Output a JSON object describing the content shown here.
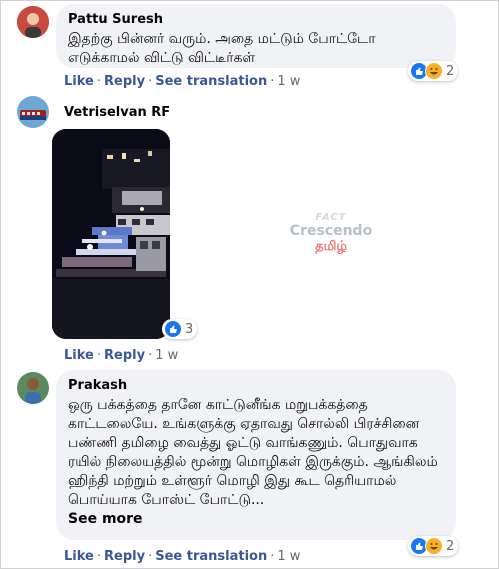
{
  "comments": [
    {
      "author": "Pattu Suresh",
      "text": "இதற்கு பின்னர் வரும். அதை மட்டும் போட்டோ எடுக்காமல் விட்டு விட்டீர்கள்",
      "actions": {
        "like": "Like",
        "reply": "Reply",
        "translate": "See translation",
        "time": "1 w"
      },
      "reaction_count": "2"
    },
    {
      "author": "Vetriselvan RF",
      "actions": {
        "like": "Like",
        "reply": "Reply",
        "time": "1 w"
      },
      "reaction_count": "3"
    },
    {
      "author": "Prakash",
      "text": "ஒரு பக்கத்தை தானே காட்டுனீங்க மறுபக்கத்தை காட்டலையே. உங்களுக்கு ஏதாவது சொல்லி பிரச்சினை பண்ணி தமிழை வைத்து ஓட்டு வாங்கணும். பொதுவாக ரயில் நிலையத்தில் மூன்று மொழிகள் இருக்கும். ஆங்கிலம் ஹிந்தி மற்றும் உள்ளூர் மொழி இது கூட தெரியாமல் பொய்யாக போஸ்ட் போட்டு...",
      "see_more": "See more",
      "actions": {
        "like": "Like",
        "reply": "Reply",
        "translate": "See translation",
        "time": "1 w"
      },
      "reaction_count": "2"
    }
  ],
  "watermark": {
    "line1": "FACT",
    "line2": "Crescendo",
    "line3": "தமிழ்"
  },
  "colors": {
    "bubble": "#f0f2f5",
    "link": "#385898",
    "meta": "#65676b",
    "like_blue": "#1877f2",
    "haha_yellow": "#f7b125"
  }
}
